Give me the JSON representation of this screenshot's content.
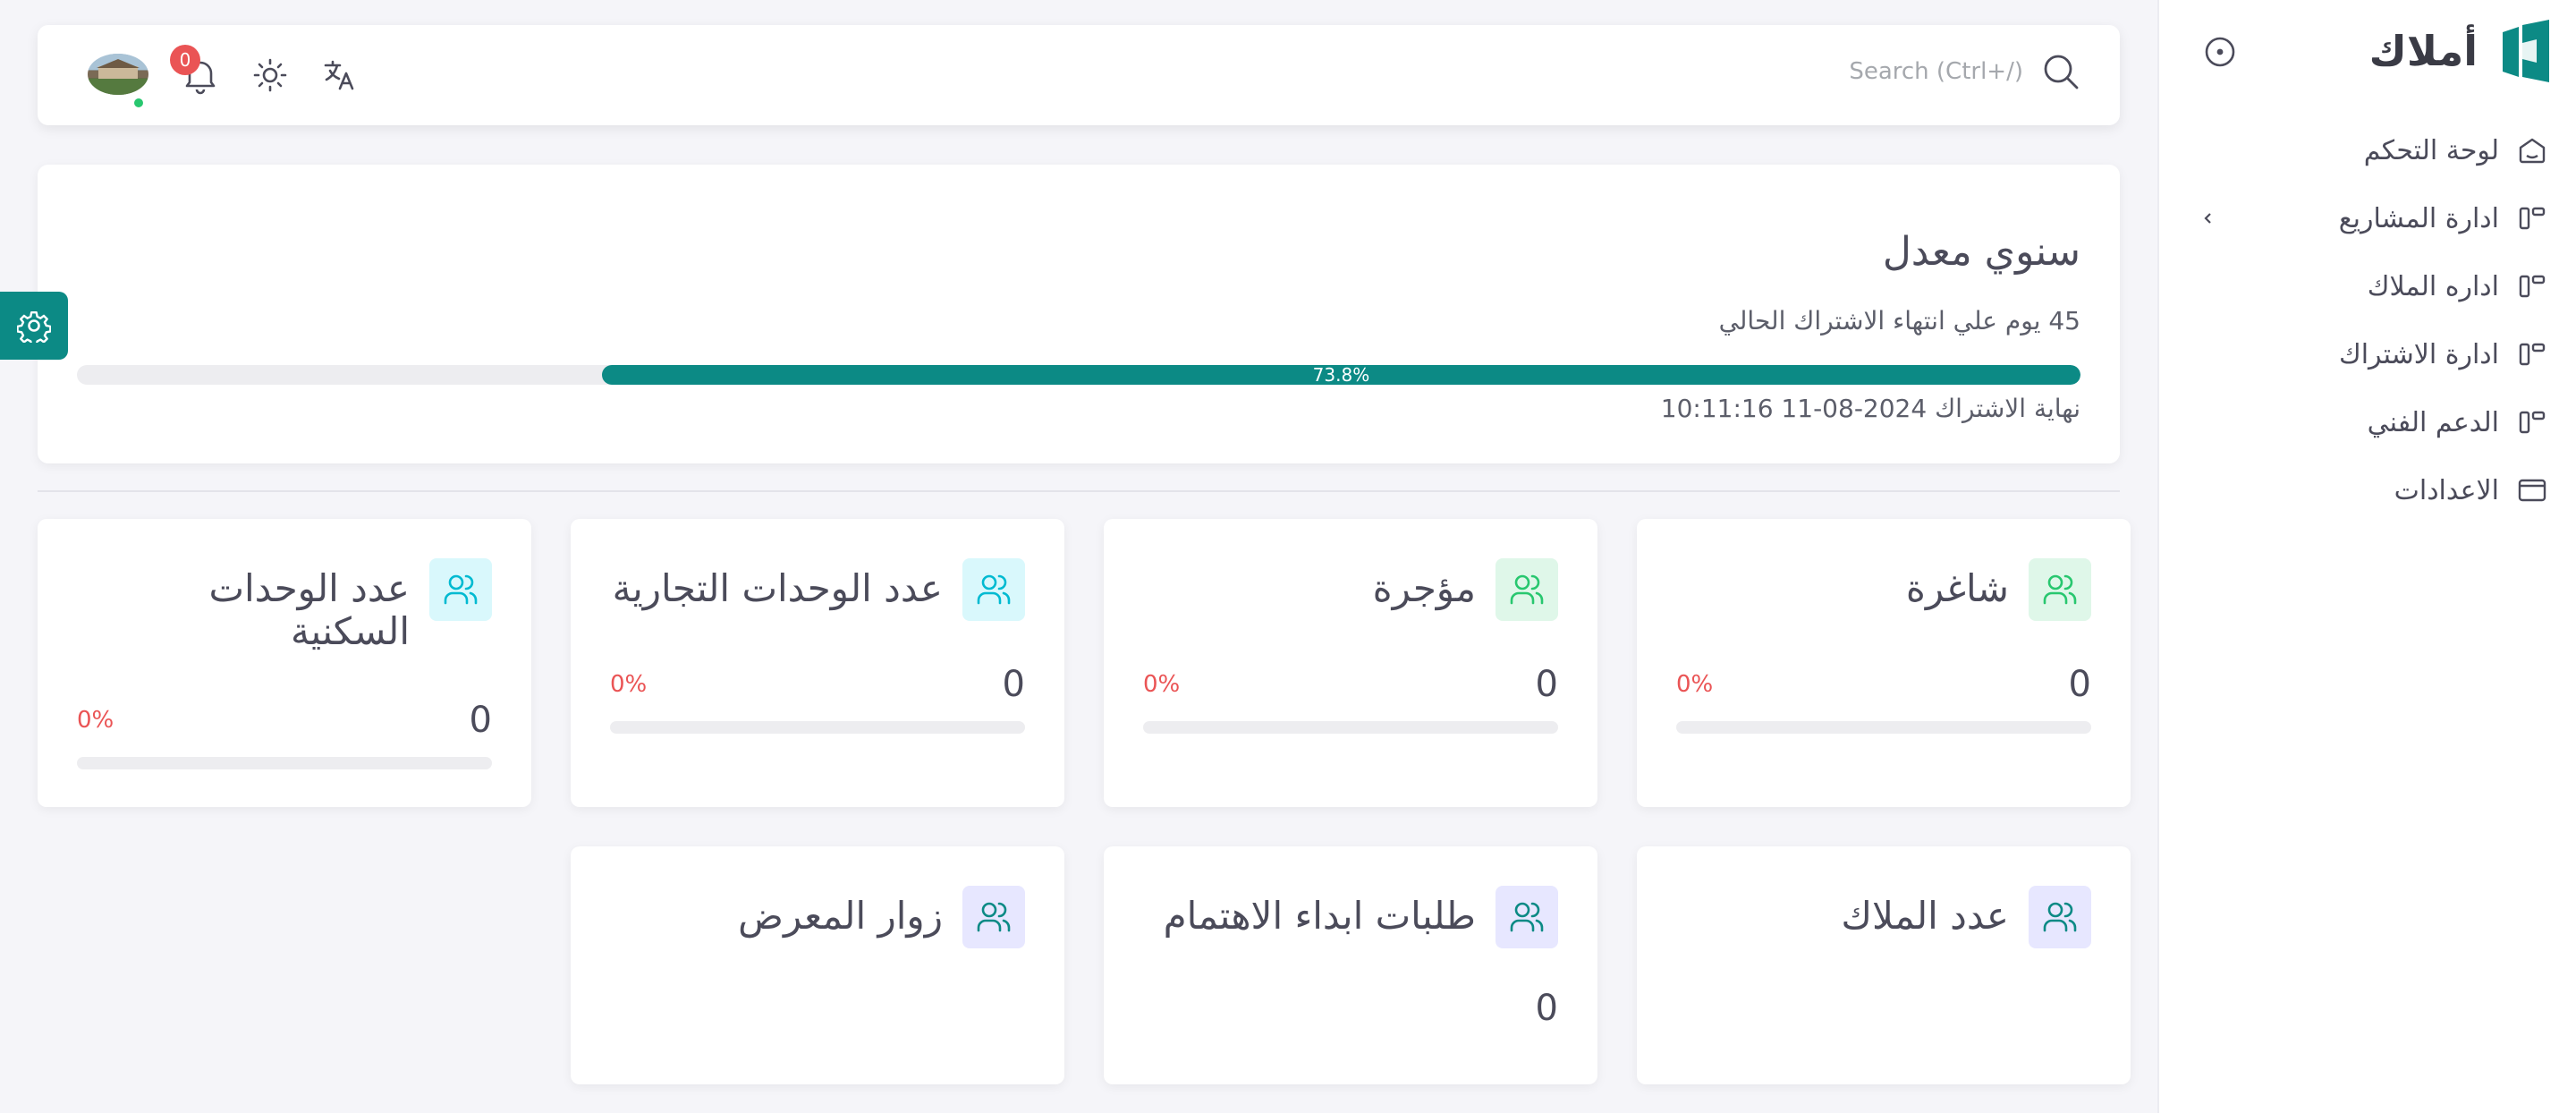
{
  "app": {
    "name": "أملاك"
  },
  "sidebar": {
    "items": [
      {
        "label": "لوحة التحكم",
        "icon": "home-icon"
      },
      {
        "label": "ادارة المشاريع",
        "icon": "grid-icon",
        "has_submenu": true
      },
      {
        "label": "اداره الملاك",
        "icon": "grid-icon"
      },
      {
        "label": "ادارة الاشتراك",
        "icon": "grid-icon"
      },
      {
        "label": "الدعم الفني",
        "icon": "grid-icon"
      },
      {
        "label": "الاعدادات",
        "icon": "window-icon"
      }
    ]
  },
  "header": {
    "search_placeholder": "Search (Ctrl+/)",
    "notification_count": "0",
    "user_status": "online"
  },
  "subscription": {
    "title": "سنوي معدل",
    "remaining": "45 يوم علي انتهاء الاشتراك الحالي",
    "progress_label": "73.8%",
    "progress": 0.738,
    "end_date": "نهاية الاشتراك 2024-08-11 10:11:16"
  },
  "stats": [
    {
      "title": "شاغرة",
      "value": "0",
      "percent": "0%",
      "icon": "users-icon",
      "icon_color": "#28c76f",
      "icon_bg": "#dff7e9"
    },
    {
      "title": "مؤجرة",
      "value": "0",
      "percent": "0%",
      "icon": "users-icon",
      "icon_color": "#28c76f",
      "icon_bg": "#dff7e9"
    },
    {
      "title": "عدد الوحدات التجارية",
      "value": "0",
      "percent": "0%",
      "icon": "users-icon",
      "icon_color": "#00bad1",
      "icon_bg": "#d9f8fc"
    },
    {
      "title": "عدد الوحدات السكنية",
      "value": "0",
      "percent": "0%",
      "icon": "users-icon",
      "icon_color": "#00bad1",
      "icon_bg": "#d9f8fc"
    },
    {
      "title": "عدد الملاك",
      "value": "",
      "icon": "users-icon",
      "icon_color": "#0c8a85",
      "icon_bg": "#e7e7ff"
    },
    {
      "title": "طلبات ابداء الاهتمام",
      "value": "0",
      "icon": "users-icon",
      "icon_color": "#0c8a85",
      "icon_bg": "#e7e7ff"
    },
    {
      "title": "زوار المعرض",
      "value": "",
      "icon": "users-icon",
      "icon_color": "#0c8a85",
      "icon_bg": "#e7e7ff"
    }
  ],
  "colors": {
    "primary": "#0c8a85",
    "danger": "#ea5455",
    "success": "#28c76f",
    "info": "#00bad1"
  }
}
